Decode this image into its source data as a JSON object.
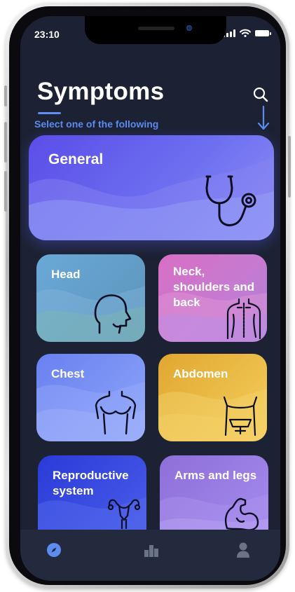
{
  "status_bar": {
    "time": "23:10"
  },
  "header": {
    "title": "Symptoms",
    "subtitle": "Select one of the following"
  },
  "categories": [
    {
      "label": "General",
      "icon": "stethoscope-icon"
    },
    {
      "label": "Head",
      "icon": "head-profile-icon"
    },
    {
      "label": "Neck,\nshoulders and\nback",
      "icon": "back-icon"
    },
    {
      "label": "Chest",
      "icon": "chest-icon"
    },
    {
      "label": "Abdomen",
      "icon": "abdomen-icon"
    },
    {
      "label": "Reproductive\nsystem",
      "icon": "uterus-icon"
    },
    {
      "label": "Arms and legs",
      "icon": "flexed-arm-icon"
    }
  ],
  "tabbar": {
    "items": [
      {
        "icon": "compass-icon",
        "active": true
      },
      {
        "icon": "bar-chart-icon",
        "active": false
      },
      {
        "icon": "profile-icon",
        "active": false
      }
    ]
  },
  "colors": {
    "background": "#1c2233",
    "accent": "#5d8bf0",
    "tabbar": "#232a3e"
  }
}
